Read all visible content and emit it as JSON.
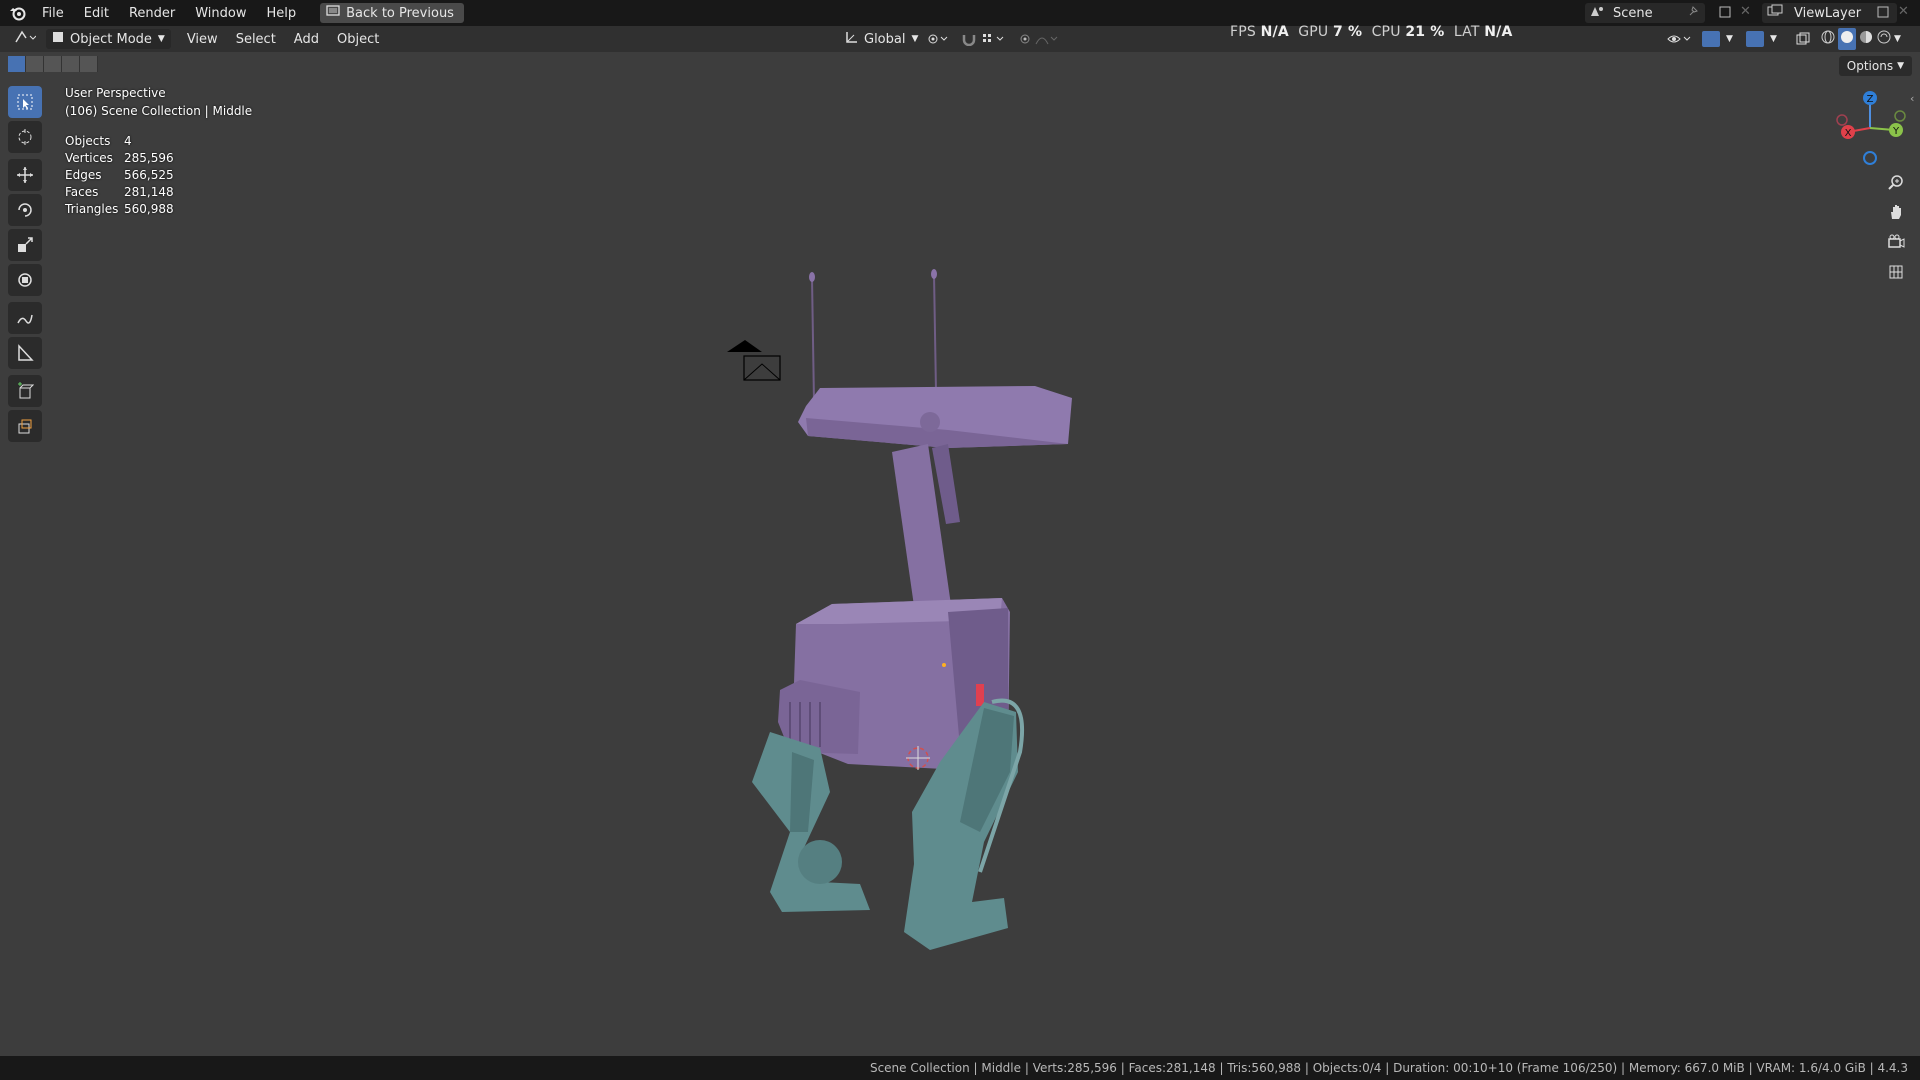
{
  "topbar": {
    "menus": [
      "File",
      "Edit",
      "Render",
      "Window",
      "Help"
    ],
    "back_button": "Back to Previous",
    "scene": "Scene",
    "view_layer": "ViewLayer"
  },
  "header": {
    "mode": "Object Mode",
    "menus": [
      "View",
      "Select",
      "Add",
      "Object"
    ],
    "transform_orientation": "Global"
  },
  "perf": {
    "fps_label": "FPS",
    "fps": "N/A",
    "gpu_label": "GPU",
    "gpu": "7 %",
    "cpu_label": "CPU",
    "cpu": "21 %",
    "lat_label": "LAT",
    "lat": "N/A"
  },
  "viewport": {
    "perspective": "User Perspective",
    "collection": "(106) Scene Collection | Middle",
    "options": "Options",
    "stats": [
      {
        "label": "Objects",
        "value": "4"
      },
      {
        "label": "Vertices",
        "value": "285,596"
      },
      {
        "label": "Edges",
        "value": "566,525"
      },
      {
        "label": "Faces",
        "value": "281,148"
      },
      {
        "label": "Triangles",
        "value": "560,988"
      }
    ],
    "gizmo": {
      "z": "Z",
      "y": "Y",
      "x": "X"
    }
  },
  "status_bar": "Scene Collection | Middle | Verts:285,596 | Faces:281,148 | Tris:560,988 | Objects:0/4 | Duration: 00:10+10 (Frame 106/250) | Memory: 667.0 MiB | VRAM: 1.6/4.0 GiB | 4.4.3",
  "colors": {
    "accent": "#4772b3",
    "body": "#8a73a8",
    "legs": "#5f8c8e"
  },
  "icons": [
    "blender-logo-icon",
    "select-box-icon",
    "cursor-icon",
    "move-icon",
    "rotate-icon",
    "scale-icon",
    "transform-icon",
    "annotate-icon",
    "measure-icon",
    "add-cube-icon",
    "extrude-icon",
    "zoom-icon",
    "hand-icon",
    "camera-icon",
    "grid-icon"
  ]
}
